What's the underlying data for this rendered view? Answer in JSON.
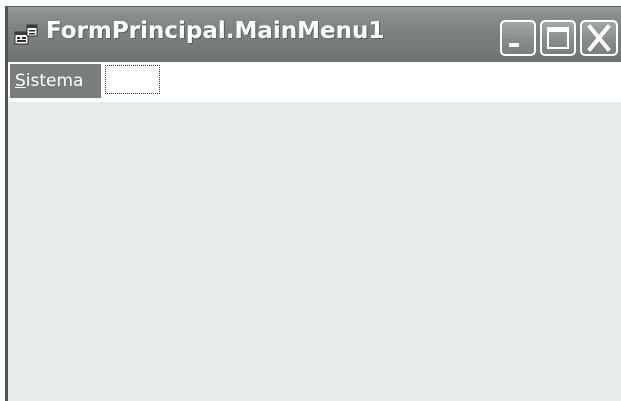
{
  "window": {
    "title": "FormPrincipal.MainMenu1",
    "icon": "form-window-icon",
    "controls": {
      "minimize_icon": "minimize-icon",
      "maximize_icon": "maximize-icon",
      "close_icon": "close-icon"
    }
  },
  "menubar": {
    "items": [
      {
        "label_mnemonic": "S",
        "label_rest": "istema"
      }
    ],
    "placeholder_icon": "new-menu-item-placeholder"
  },
  "colors": {
    "titlebar": "#808281",
    "menu_item_selected": "#7b7d7c",
    "client_background": "#e9eaea",
    "title_text": "#ffffff"
  }
}
